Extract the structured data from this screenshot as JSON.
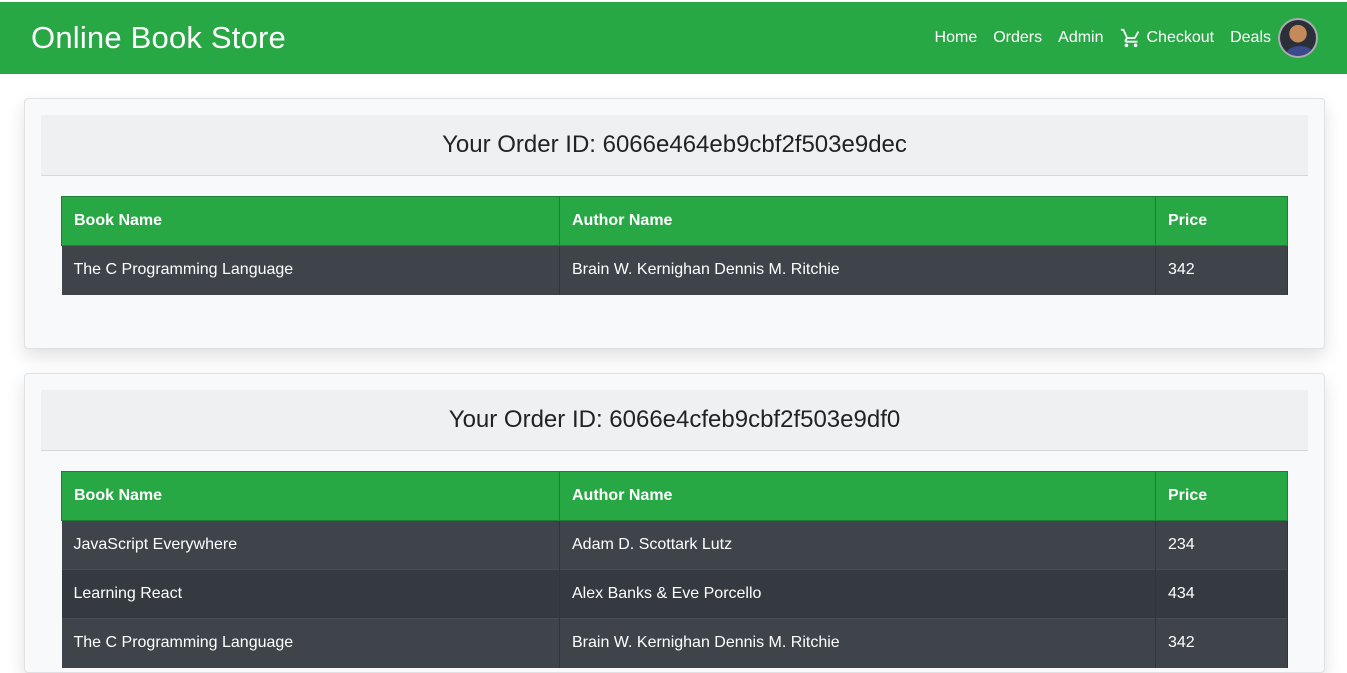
{
  "header": {
    "brand": "Online Book Store",
    "nav": [
      "Home",
      "Orders",
      "Admin",
      "Checkout",
      "Deals"
    ]
  },
  "table_headers": [
    "Book Name",
    "Author Name",
    "Price"
  ],
  "orders": [
    {
      "title": "Your Order ID: 6066e464eb9cbf2f503e9dec",
      "rows": [
        [
          "The C Programming Language",
          "Brain W. Kernighan Dennis M. Ritchie",
          "342"
        ]
      ]
    },
    {
      "title": "Your Order ID: 6066e4cfeb9cbf2f503e9df0",
      "rows": [
        [
          "JavaScript Everywhere",
          "Adam D. Scottark Lutz",
          "234"
        ],
        [
          "Learning React",
          "Alex Banks & Eve Porcello",
          "434"
        ],
        [
          "The C Programming Language",
          "Brain W. Kernighan Dennis M. Ritchie",
          "342"
        ]
      ]
    }
  ],
  "colors": {
    "primary": "#28a745",
    "table_dark": "#343a40",
    "table_dark_alt": "#3f444b"
  }
}
